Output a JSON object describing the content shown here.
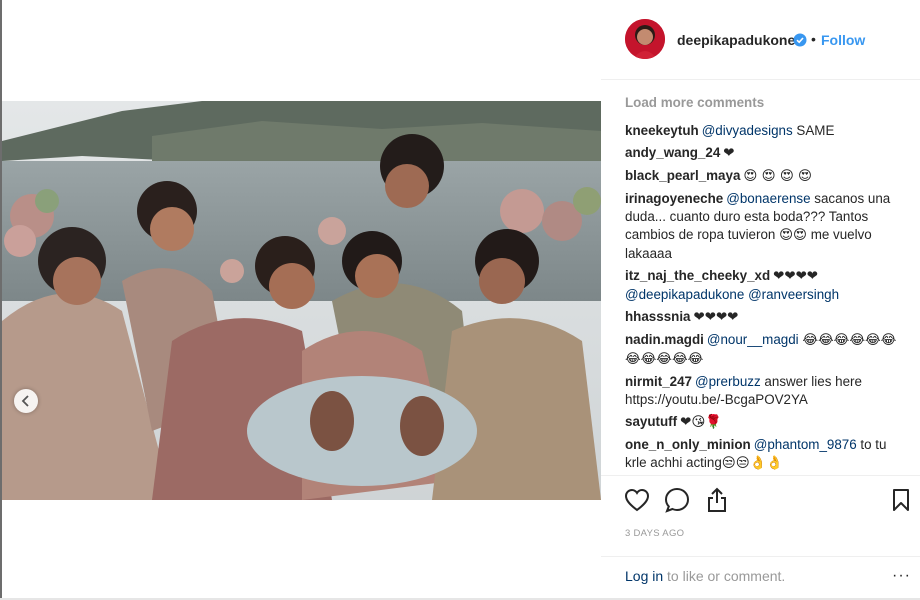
{
  "post": {
    "username": "deepikapadukone",
    "dot": "•",
    "follow_label": "Follow",
    "load_more": "Load more comments",
    "timestamp": "3 DAYS AGO",
    "login_link": "Log in",
    "login_rest": " to like or comment.",
    "more_label": "···"
  },
  "comments": [
    {
      "user": "kneekeytuh",
      "parts": [
        {
          "t": "@divyadesigns",
          "m": true
        },
        {
          "t": " SAME",
          "m": false
        }
      ]
    },
    {
      "user": "andy_wang_24",
      "parts": [
        {
          "t": "❤",
          "m": false,
          "e": true
        }
      ]
    },
    {
      "user": "black_pearl_maya",
      "parts": [
        {
          "t": "😍 😍 😍 😍",
          "m": false,
          "e": true
        }
      ]
    },
    {
      "user": "irinagoyeneche",
      "parts": [
        {
          "t": "@bonaerense",
          "m": true
        },
        {
          "t": " sacanos una duda... cuanto duro esta boda??? Tantos cambios de ropa tuvieron ",
          "m": false
        },
        {
          "t": "😍😍",
          "m": false,
          "e": true
        },
        {
          "t": " me vuelvo lakaaaa",
          "m": false
        }
      ]
    },
    {
      "user": "itz_naj_the_cheeky_xd",
      "parts": [
        {
          "t": "❤❤❤❤",
          "m": false,
          "e": true
        },
        {
          "t": " ",
          "m": false
        },
        {
          "t": "@deepikapadukone",
          "m": true
        },
        {
          "t": " ",
          "m": false
        },
        {
          "t": "@ranveersingh",
          "m": true
        }
      ]
    },
    {
      "user": "hhasssnia",
      "parts": [
        {
          "t": "❤❤❤❤",
          "m": false,
          "e": true
        }
      ]
    },
    {
      "user": "nadin.magdi",
      "parts": [
        {
          "t": "@nour__magdi",
          "m": true
        },
        {
          "t": " ",
          "m": false
        },
        {
          "t": "😂😂😂😂😂😂😂😂😂😂😂",
          "m": false,
          "e": true
        }
      ]
    },
    {
      "user": "nirmit_247",
      "parts": [
        {
          "t": "@prerbuzz",
          "m": true
        },
        {
          "t": " answer lies here https://youtu.be/-BcgaPOV2YA",
          "m": false
        }
      ]
    },
    {
      "user": "sayutuff",
      "parts": [
        {
          "t": "❤😘🌹",
          "m": false,
          "e": true
        }
      ]
    },
    {
      "user": "one_n_only_minion",
      "parts": [
        {
          "t": "@phantom_9876",
          "m": true
        },
        {
          "t": " to tu krle achhi acting",
          "m": false
        },
        {
          "t": "😒😒👌👌",
          "m": false,
          "e": true
        }
      ]
    }
  ],
  "icons": {
    "like": "heart-outline-icon",
    "comment": "speech-bubble-icon",
    "share": "share-icon",
    "save": "bookmark-icon",
    "verified": "verified-badge-icon",
    "prev": "chevron-left-icon"
  },
  "colors": {
    "link": "#3897f0",
    "mention": "#003569",
    "muted": "#999999",
    "text": "#262626"
  }
}
